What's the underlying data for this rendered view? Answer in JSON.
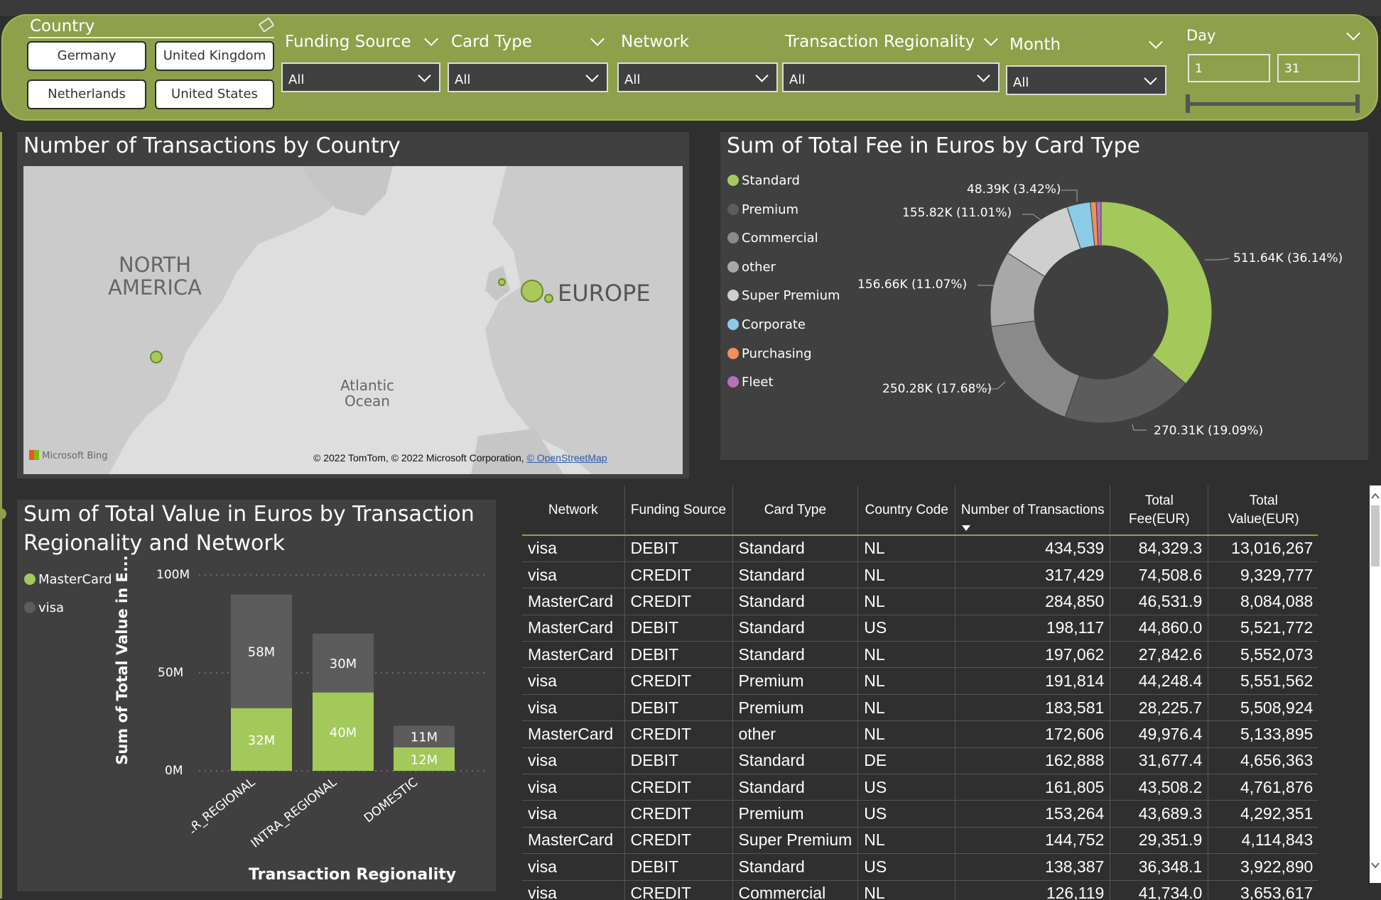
{
  "filters": {
    "country": {
      "title": "Country",
      "buttons": [
        "Germany",
        "United Kingdom",
        "Netherlands",
        "United States"
      ]
    },
    "funding_source": {
      "label": "Funding Source",
      "value": "All"
    },
    "card_type": {
      "label": "Card Type",
      "value": "All"
    },
    "network": {
      "label": "Network",
      "value": "All"
    },
    "transaction_regionality": {
      "label": "Transaction Regionality",
      "value": "All"
    },
    "month": {
      "label": "Month",
      "value": "All"
    },
    "day": {
      "label": "Day",
      "from": "1",
      "to": "31"
    }
  },
  "map_panel": {
    "title": "Number of Transactions by Country",
    "labels": {
      "north_america": "NORTH AMERICA",
      "europe": "EUROPE",
      "ocean": "Atlantic Ocean"
    },
    "bing": "Microsoft Bing",
    "copyright": "© 2022 TomTom, © 2022 Microsoft Corporation,",
    "osm_link": "© OpenStreetMap"
  },
  "donut_panel": {
    "title": "Sum of Total Fee in Euros by Card Type",
    "legend": [
      {
        "name": "Standard",
        "color": "#a3c95a"
      },
      {
        "name": "Premium",
        "color": "#5c5c5c"
      },
      {
        "name": "Commercial",
        "color": "#8a8a8a"
      },
      {
        "name": "other",
        "color": "#a8a8a8"
      },
      {
        "name": "Super Premium",
        "color": "#cfcfcf"
      },
      {
        "name": "Corporate",
        "color": "#8ccbe8"
      },
      {
        "name": "Purchasing",
        "color": "#f0905a"
      },
      {
        "name": "Fleet",
        "color": "#b76fb7"
      }
    ],
    "labels": {
      "standard": "511.64K (36.14%)",
      "premium": "270.31K (19.09%)",
      "commercial": "250.28K (17.68%)",
      "other": "156.66K (11.07%)",
      "super_premium": "155.82K (11.01%)",
      "corporate": "48.39K (3.42%)"
    }
  },
  "bar_panel": {
    "title_line1": "Sum of Total Value in Euros by Transaction",
    "title_line2": "Regionality and Network",
    "legend": [
      {
        "name": "MasterCard",
        "color": "#a3c95a"
      },
      {
        "name": "visa",
        "color": "#5c5c5c"
      }
    ],
    "ylabel": "Sum of Total Value in E...",
    "xlabel": "Transaction Regionality",
    "yticks": [
      "100M",
      "50M",
      "0M"
    ]
  },
  "chart_data": [
    {
      "type": "pie",
      "title": "Sum of Total Fee in Euros by Card Type",
      "categories": [
        "Standard",
        "Premium",
        "Commercial",
        "other",
        "Super Premium",
        "Corporate",
        "Purchasing",
        "Fleet"
      ],
      "values": [
        511640,
        270310,
        250280,
        156660,
        155820,
        48390,
        12000,
        10000
      ],
      "donut": true
    },
    {
      "type": "bar",
      "stacked": true,
      "title": "Sum of Total Value in Euros by Transaction Regionality and Network",
      "categories": [
        "INTER_REGIONAL",
        "INTRA_REGIONAL",
        "DOMESTIC"
      ],
      "series": [
        {
          "name": "MasterCard",
          "values": [
            32,
            40,
            12
          ],
          "labels": [
            "32M",
            "40M",
            "12M"
          ]
        },
        {
          "name": "visa",
          "values": [
            58,
            30,
            11
          ],
          "labels": [
            "58M",
            "30M",
            "11M"
          ]
        }
      ],
      "ylim": [
        0,
        100
      ],
      "xlabel": "Transaction Regionality",
      "ylabel": "Sum of Total Value in E..."
    }
  ],
  "table": {
    "columns": [
      "Network",
      "Funding Source",
      "Card Type",
      "Country Code",
      "Number of Transactions",
      "Total Fee(EUR)",
      "Total Value(EUR)"
    ],
    "rows": [
      [
        "visa",
        "DEBIT",
        "Standard",
        "NL",
        "434,539",
        "84,329.3",
        "13,016,267"
      ],
      [
        "visa",
        "CREDIT",
        "Standard",
        "NL",
        "317,429",
        "74,508.6",
        "9,329,777"
      ],
      [
        "MasterCard",
        "CREDIT",
        "Standard",
        "NL",
        "284,850",
        "46,531.9",
        "8,084,088"
      ],
      [
        "MasterCard",
        "DEBIT",
        "Standard",
        "US",
        "198,117",
        "44,860.0",
        "5,521,772"
      ],
      [
        "MasterCard",
        "DEBIT",
        "Standard",
        "NL",
        "197,062",
        "27,842.6",
        "5,552,073"
      ],
      [
        "visa",
        "CREDIT",
        "Premium",
        "NL",
        "191,814",
        "44,248.4",
        "5,551,562"
      ],
      [
        "visa",
        "DEBIT",
        "Premium",
        "NL",
        "183,581",
        "28,225.7",
        "5,508,924"
      ],
      [
        "MasterCard",
        "CREDIT",
        "other",
        "NL",
        "172,606",
        "49,976.4",
        "5,133,895"
      ],
      [
        "visa",
        "DEBIT",
        "Standard",
        "DE",
        "162,888",
        "31,677.4",
        "4,656,363"
      ],
      [
        "visa",
        "CREDIT",
        "Standard",
        "US",
        "161,805",
        "43,508.2",
        "4,761,876"
      ],
      [
        "visa",
        "CREDIT",
        "Premium",
        "US",
        "153,264",
        "43,689.3",
        "4,292,351"
      ],
      [
        "MasterCard",
        "CREDIT",
        "Super Premium",
        "NL",
        "144,752",
        "29,351.9",
        "4,114,843"
      ],
      [
        "visa",
        "DEBIT",
        "Standard",
        "US",
        "138,387",
        "36,348.1",
        "3,922,890"
      ],
      [
        "visa",
        "CREDIT",
        "Commercial",
        "NL",
        "126,119",
        "41,734.0",
        "3,653,617"
      ]
    ]
  }
}
